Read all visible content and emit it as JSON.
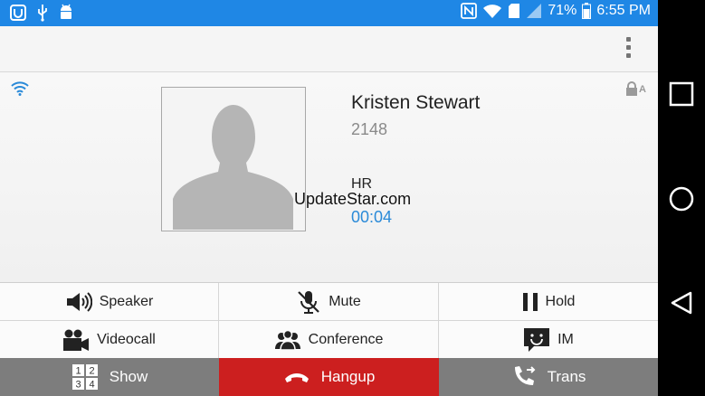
{
  "status_bar": {
    "battery": "71%",
    "time": "6:55 PM",
    "icons": [
      "app-icon",
      "usb-icon",
      "android-icon",
      "nfc-icon",
      "wifi-signal-icon",
      "sim-icon",
      "cell-signal-icon",
      "battery-icon"
    ]
  },
  "action_bar": {
    "overflow_icon": "overflow-menu-icon"
  },
  "call": {
    "contact_name": "Kristen Stewart",
    "number": "2148",
    "department": "HR",
    "duration": "00:04",
    "watermark": "UpdateStar.com",
    "connection_icon": "wifi-icon",
    "secure_icon": "lock-icon",
    "lock_letter": "A"
  },
  "controls": {
    "speaker": "Speaker",
    "mute": "Mute",
    "hold": "Hold",
    "videocall": "Videocall",
    "conference": "Conference",
    "im": "IM",
    "show": "Show",
    "hangup": "Hangup",
    "trans": "Trans",
    "keypad_digits": [
      "1",
      "2",
      "3",
      "4"
    ]
  },
  "colors": {
    "status_bar": "#1f87e5",
    "accent": "#2a8ad8",
    "hangup": "#cc1f1f",
    "bottom_gray": "#7d7d7d"
  }
}
